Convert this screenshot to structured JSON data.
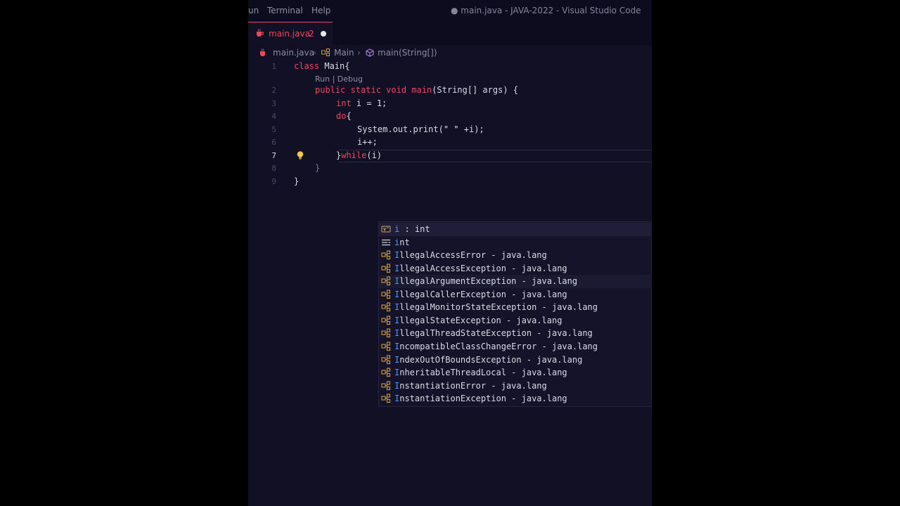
{
  "titlebar": {
    "menu": [
      "un",
      "Terminal",
      "Help"
    ],
    "title": "● main.java - JAVA-2022 - Visual Studio Code"
  },
  "tabs": [
    {
      "name": "main.java",
      "problems": "2",
      "dirty": true
    }
  ],
  "breadcrumb": {
    "file": "main.java",
    "class": "Main",
    "method": "main(String[])"
  },
  "codelens": "Run | Debug",
  "editor": {
    "active_line": 7,
    "lines": [
      {
        "n": "1",
        "indent": 0,
        "parts": [
          [
            "kw",
            "class "
          ],
          [
            "",
            "Main{"
          ]
        ]
      },
      {
        "n": "2",
        "indent": 1,
        "parts": [
          [
            "kw",
            "public static void "
          ],
          [
            "fn",
            "main"
          ],
          [
            "",
            "(String[] args) {"
          ]
        ]
      },
      {
        "n": "3",
        "indent": 2,
        "parts": [
          [
            "kw",
            "int "
          ],
          [
            "",
            "i = "
          ],
          [
            "num",
            "1"
          ],
          [
            "",
            ";"
          ]
        ]
      },
      {
        "n": "4",
        "indent": 2,
        "parts": [
          [
            "kw",
            "do"
          ],
          [
            "",
            "{"
          ]
        ]
      },
      {
        "n": "5",
        "indent": 3,
        "parts": [
          [
            "",
            "System.out.print("
          ],
          [
            "str",
            "\" \""
          ],
          [
            "",
            " +i);"
          ]
        ]
      },
      {
        "n": "6",
        "indent": 3,
        "parts": [
          [
            "",
            "i++;"
          ]
        ]
      },
      {
        "n": "7",
        "indent": 2,
        "parts": [
          [
            "",
            "}"
          ],
          [
            "kw",
            "while"
          ],
          [
            "",
            "(i)"
          ]
        ]
      },
      {
        "n": "8",
        "indent": 1,
        "parts": [
          [
            "dim",
            "}"
          ]
        ]
      },
      {
        "n": "9",
        "indent": 0,
        "parts": [
          [
            "",
            "}"
          ]
        ]
      }
    ]
  },
  "suggestions": [
    {
      "kind": "variable",
      "match": "i",
      "rest": " : int",
      "state": "selected"
    },
    {
      "kind": "keyword",
      "match": "i",
      "rest": "nt",
      "state": ""
    },
    {
      "kind": "class",
      "match": "I",
      "rest": "llegalAccessError - java.lang",
      "state": ""
    },
    {
      "kind": "class",
      "match": "I",
      "rest": "llegalAccessException - java.lang",
      "state": ""
    },
    {
      "kind": "class",
      "match": "I",
      "rest": "llegalArgumentException - java.lang",
      "state": "hover"
    },
    {
      "kind": "class",
      "match": "I",
      "rest": "llegalCallerException - java.lang",
      "state": ""
    },
    {
      "kind": "class",
      "match": "I",
      "rest": "llegalMonitorStateException - java.lang",
      "state": ""
    },
    {
      "kind": "class",
      "match": "I",
      "rest": "llegalStateException - java.lang",
      "state": ""
    },
    {
      "kind": "class",
      "match": "I",
      "rest": "llegalThreadStateException - java.lang",
      "state": ""
    },
    {
      "kind": "class",
      "match": "I",
      "rest": "ncompatibleClassChangeError - java.lang",
      "state": ""
    },
    {
      "kind": "class",
      "match": "I",
      "rest": "ndexOutOfBoundsException - java.lang",
      "state": ""
    },
    {
      "kind": "class",
      "match": "I",
      "rest": "nheritableThreadLocal - java.lang",
      "state": ""
    },
    {
      "kind": "class",
      "match": "I",
      "rest": "nstantiationError - java.lang",
      "state": ""
    },
    {
      "kind": "class",
      "match": "I",
      "rest": "nstantiationException - java.lang",
      "state": ""
    }
  ],
  "colors": {
    "accent": "#f0465d",
    "match": "#3b9cff",
    "background": "#111024"
  }
}
